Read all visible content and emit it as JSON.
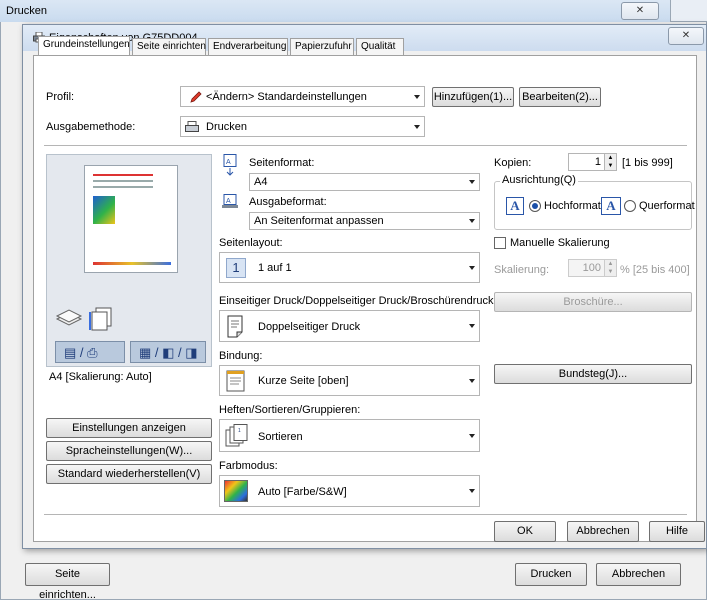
{
  "outer": {
    "title": "Drucken",
    "close": "✕",
    "page_setup": "Seite einrichten...",
    "print": "Drucken",
    "cancel": "Abbrechen"
  },
  "inner": {
    "title": "Eigenschaften von G75DD004",
    "close": "✕"
  },
  "tabs": [
    "Grundeinstellungen",
    "Seite einrichten",
    "Endverarbeitung",
    "Papierzufuhr",
    "Qualität"
  ],
  "profile": {
    "label": "Profil:",
    "value": "<Ändern> Standardeinstellungen",
    "add": "Hinzufügen(1)...",
    "edit": "Bearbeiten(2)..."
  },
  "output": {
    "label": "Ausgabemethode:",
    "value": "Drucken"
  },
  "preview": {
    "caption": "A4 [Skalierung: Auto]"
  },
  "left_buttons": {
    "show_settings": "Einstellungen anzeigen",
    "language": "Spracheinstellungen(W)...",
    "restore": "Standard wiederherstellen(V)"
  },
  "page_size": {
    "label": "Seitenformat:",
    "value": "A4"
  },
  "output_size": {
    "label": "Ausgabeformat:",
    "value": "An Seitenformat anpassen"
  },
  "layout": {
    "label": "Seitenlayout:",
    "value": "1 auf 1",
    "badge": "1"
  },
  "duplex": {
    "label": "Einseitiger Druck/Doppelseitiger Druck/Broschürendruck:",
    "value": "Doppelseitiger Druck"
  },
  "binding": {
    "label": "Bindung:",
    "value": "Kurze Seite [oben]"
  },
  "stapling": {
    "label": "Heften/Sortieren/Gruppieren:",
    "value": "Sortieren"
  },
  "color": {
    "label": "Farbmodus:",
    "value": "Auto [Farbe/S&W]"
  },
  "copies": {
    "label": "Kopien:",
    "value": "1",
    "range": "[1 bis 999]"
  },
  "orientation": {
    "label": "Ausrichtung(Q)",
    "portrait": "Hochformat",
    "landscape": "Querformat"
  },
  "scaling": {
    "manual": "Manuelle Skalierung",
    "label": "Skalierung:",
    "value": "100",
    "range": "% [25 bis 400]"
  },
  "brochure": "Broschüre...",
  "gutter": "Bundsteg(J)...",
  "dialog_buttons": {
    "ok": "OK",
    "cancel": "Abbrechen",
    "help": "Hilfe"
  }
}
